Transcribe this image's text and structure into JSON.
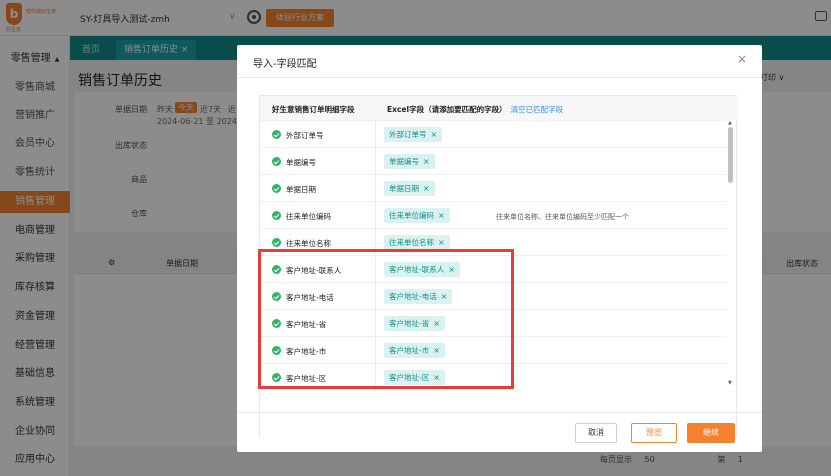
{
  "header": {
    "logo_mark": "b",
    "logo_name": "帮你做好生意",
    "logo_sub": "好生意",
    "account": "SY-灯具导入测试-zmh",
    "trial_button": "体验行业方案"
  },
  "sidebar": {
    "items": [
      {
        "label": "零售管理",
        "caret": "▲"
      },
      {
        "label": "零售商城"
      },
      {
        "label": "营销推广"
      },
      {
        "label": "会员中心"
      },
      {
        "label": "零售统计"
      },
      {
        "label": "销售管理"
      },
      {
        "label": "电商管理"
      },
      {
        "label": "采购管理"
      },
      {
        "label": "库存核算"
      },
      {
        "label": "资金管理"
      },
      {
        "label": "经营管理"
      },
      {
        "label": "基础信息"
      },
      {
        "label": "系统管理"
      },
      {
        "label": "企业协同"
      },
      {
        "label": "应用中心"
      }
    ]
  },
  "tabs": [
    {
      "label": "首页"
    },
    {
      "label": "销售订单历史 ×"
    }
  ],
  "page": {
    "title": "销售订单历史",
    "print_menu": "打印 ∨",
    "filters": {
      "date_label": "单据日期",
      "yesterday": "昨天",
      "today": "今天",
      "last7": "近7天",
      "recent": "近",
      "date_range": "2024-06-21 至 2024-0",
      "outbound_label": "出库状态",
      "goods_label": "商品",
      "warehouse_label": "仓库"
    },
    "grid_headers": {
      "date": "单据日期",
      "outbound": "出库状态"
    },
    "footer": {
      "page_size_label": "每页显示",
      "page_size": "50",
      "page_label": "第",
      "page_num": "1"
    }
  },
  "modal": {
    "title": "导入-字段匹配",
    "col1_header": "好生意销售订单明细字段",
    "col2_header": "Excel字段（请添加要匹配的字段）",
    "clear_link": "清空已匹配字段",
    "rows": [
      {
        "field": "外部订单号",
        "tag": "外部订单号",
        "hint": ""
      },
      {
        "field": "单据编号",
        "tag": "单据编号",
        "hint": ""
      },
      {
        "field": "单据日期",
        "tag": "单据日期",
        "hint": ""
      },
      {
        "field": "往来单位编码",
        "tag": "往来单位编码",
        "hint": "往来单位名称、往来单位编码至少匹配一个"
      },
      {
        "field": "往来单位名称",
        "tag": "往来单位名称",
        "hint": ""
      },
      {
        "field": "客户地址-联系人",
        "tag": "客户地址-联系人",
        "hint": ""
      },
      {
        "field": "客户地址-电话",
        "tag": "客户地址-电话",
        "hint": ""
      },
      {
        "field": "客户地址-省",
        "tag": "客户地址-省",
        "hint": ""
      },
      {
        "field": "客户地址-市",
        "tag": "客户地址-市",
        "hint": ""
      },
      {
        "field": "客户地址-区",
        "tag": "客户地址-区",
        "hint": ""
      }
    ],
    "buttons": {
      "cancel": "取消",
      "preview": "预览",
      "continue": "继续"
    }
  },
  "colors": {
    "brand_orange": "#f5812f",
    "teal_tabbar": "#0f8a8a",
    "tag_bg": "#d9f1ef",
    "tag_text": "#14908a",
    "check_green": "#2fb36d",
    "annotation_red": "#e83b3b"
  }
}
